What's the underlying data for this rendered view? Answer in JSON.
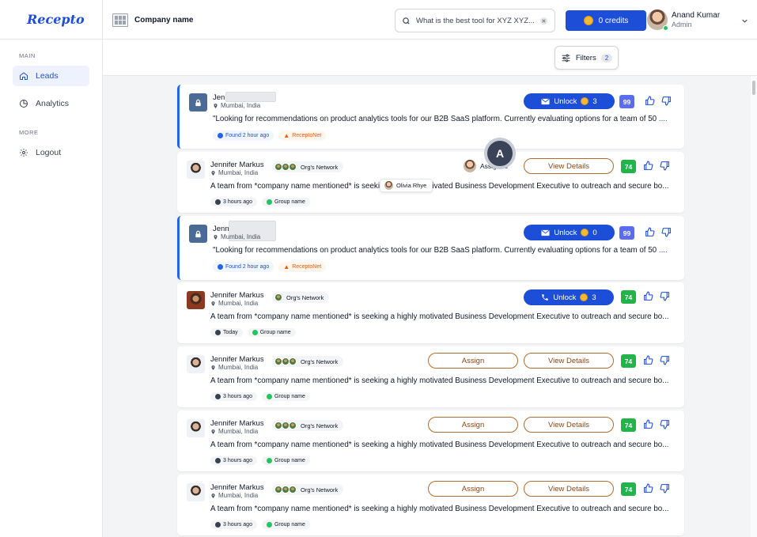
{
  "app": {
    "logo": "Recepto"
  },
  "sidebar": {
    "main_label": "MAIN",
    "more_label": "MORE",
    "items": [
      {
        "label": "Leads",
        "icon": "home-icon"
      },
      {
        "label": "Analytics",
        "icon": "pie-chart-icon"
      }
    ],
    "more_items": [
      {
        "label": "Logout",
        "icon": "gear-icon"
      }
    ]
  },
  "header": {
    "company": "Company name",
    "search_value": "What is the best tool for XYZ XYZ...",
    "credits_label": "0 credits",
    "user_name": "Anand Kumar",
    "user_role": "Admin"
  },
  "filters": {
    "label": "Filters",
    "count": "2"
  },
  "overlay": {
    "cursor_letter": "A",
    "tooltip_name": "Olivia Rhye"
  },
  "colors": {
    "primary": "#1d4ed8",
    "score_blue": "#5b6cf0",
    "score_green": "#22b34a",
    "accent_orange": "#ea580c"
  },
  "leads": [
    {
      "name": "Jen",
      "location": "Mumbai, India",
      "desc": "\"Looking for recommendations on product analytics tools for our B2B SaaS platform. Currently evaluating options for a team of 50",
      "more": "....",
      "time": "Found 2 hour ago",
      "source": "ReceptoNet",
      "unlock_label": "Unlock",
      "unlock_count": "3",
      "score": "99"
    },
    {
      "name": "Jennifer Markus",
      "location": "Mumbai, India",
      "network": "Org's Network",
      "desc": "A team from *company name mentioned* is seeking a highly motivated Business Development Executive to outreach and secure bo...",
      "time": "3 hours ago",
      "group": "Group name",
      "assigned_label": "Assigned",
      "details_label": "View Details",
      "score": "74"
    },
    {
      "name": "Jenni",
      "location": "Mumbai, India",
      "desc": "\"Looking for recommendations on product analytics tools for our B2B SaaS platform. Currently evaluating options for a team of 50",
      "more": "....",
      "time": "Found 2 hour ago",
      "source": "ReceptoNet",
      "unlock_label": "Unlock",
      "unlock_count": "0",
      "score": "99"
    },
    {
      "name": "Jennifer Markus",
      "location": "Mumbai, India",
      "network": "Org's Network",
      "desc": "A team from *company name mentioned* is seeking a highly motivated Business Development Executive to outreach and secure bo...",
      "time": "Today",
      "group": "Group name",
      "unlock_label": "Unlock",
      "unlock_count": "3",
      "score": "74"
    },
    {
      "name": "Jennifer Markus",
      "location": "Mumbai, India",
      "network": "Org's Network",
      "desc": "A team from *company name mentioned* is seeking a highly motivated Business Development Executive to outreach and secure bo...",
      "time": "3 hours ago",
      "group": "Group name",
      "assign_label": "Assign",
      "details_label": "View Details",
      "score": "74"
    },
    {
      "name": "Jennifer Markus",
      "location": "Mumbai, India",
      "network": "Org's Network",
      "desc": "A team from *company name mentioned* is seeking a highly motivated Business Development Executive to outreach and secure bo...",
      "time": "3 hours ago",
      "group": "Group name",
      "assign_label": "Assign",
      "details_label": "View Details",
      "score": "74"
    },
    {
      "name": "Jennifer Markus",
      "location": "Mumbai, India",
      "network": "Org's Network",
      "desc": "A team from *company name mentioned* is seeking a highly motivated Business Development Executive to outreach and secure bo...",
      "time": "3 hours ago",
      "group": "Group name",
      "assign_label": "Assign",
      "details_label": "View Details",
      "score": "74"
    }
  ]
}
